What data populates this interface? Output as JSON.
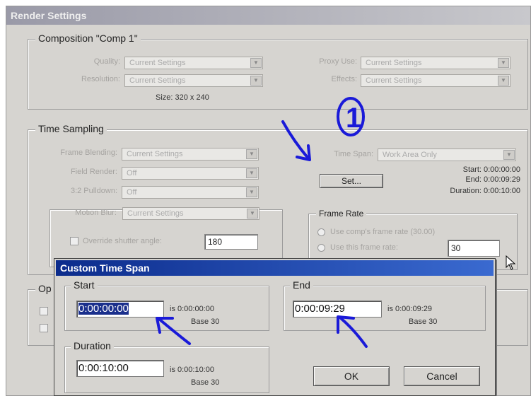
{
  "render_settings": {
    "title": "Render Settings",
    "composition": {
      "group_title": "Composition \"Comp 1\"",
      "quality_label": "Quality:",
      "quality_value": "Current Settings",
      "resolution_label": "Resolution:",
      "resolution_value": "Current Settings",
      "size_text": "Size: 320 x 240",
      "proxy_label": "Proxy Use:",
      "proxy_value": "Current Settings",
      "effects_label": "Effects:",
      "effects_value": "Current Settings"
    },
    "time_sampling": {
      "group_title": "Time Sampling",
      "frame_blending_label": "Frame Blending:",
      "frame_blending_value": "Current Settings",
      "field_render_label": "Field Render:",
      "field_render_value": "Off",
      "pulldown_label": "3:2 Pulldown:",
      "pulldown_value": "Off",
      "motion_blur_label": "Motion Blur:",
      "motion_blur_value": "Current Settings",
      "override_shutter_label": "Override shutter angle:",
      "shutter_value": "180",
      "time_span_label": "Time Span:",
      "time_span_value": "Work Area Only",
      "set_button": "Set...",
      "start_text": "Start: 0:00:00:00",
      "end_text": "End: 0:00:09:29",
      "duration_text": "Duration: 0:00:10:00",
      "frame_rate": {
        "group_title": "Frame Rate",
        "use_comp_label": "Use comp's frame rate (30.00)",
        "use_this_label": "Use this frame rate:",
        "frame_rate_value": "30"
      }
    },
    "options_group_title": "Op"
  },
  "custom_time_span": {
    "title": "Custom Time Span",
    "start": {
      "group_title": "Start",
      "value": "0:00:00:00",
      "is_text": "is 0:00:00:00",
      "base_text": "Base 30"
    },
    "end": {
      "group_title": "End",
      "value": "0:00:09:29",
      "is_text": "is 0:00:09:29",
      "base_text": "Base 30"
    },
    "duration": {
      "group_title": "Duration",
      "value": "0:00:10:00",
      "is_text": "is 0:00:10:00",
      "base_text": "Base 30"
    },
    "ok_button": "OK",
    "cancel_button": "Cancel"
  },
  "annotations": {
    "step_marker": "1",
    "color": "#1a1ad8"
  },
  "icons": [
    "dropdown-arrow-icon",
    "mouse-cursor-icon",
    "checkbox-icon",
    "radio-icon"
  ]
}
